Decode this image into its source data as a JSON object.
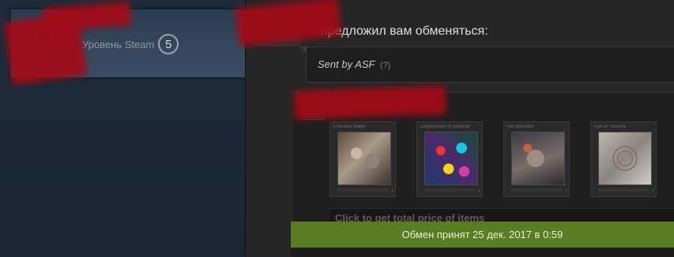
{
  "profile": {
    "level_label": "Уровень Steam",
    "level_value": "5"
  },
  "offer": {
    "header_text": "предложил вам обменяться:",
    "message_text": "Sent by ASF",
    "help_link": "(?)"
  },
  "items": [
    {
      "name": "Chimera Maker",
      "icon": "i"
    },
    {
      "name": "Drepression of Sentinel",
      "icon": "i"
    },
    {
      "name": "Re-Splendor",
      "icon": "i"
    },
    {
      "name": "Eye of Trinome",
      "icon": "i"
    }
  ],
  "price_bar": {
    "label": "Click to get total price of items"
  },
  "status": {
    "text": "Обмен принят 25 дек. 2017 в 0:59"
  },
  "colors": {
    "left_bg": "#1b2838",
    "main_bg": "#262626",
    "status_green": "#5a7d24",
    "redaction": "#a10b18"
  }
}
